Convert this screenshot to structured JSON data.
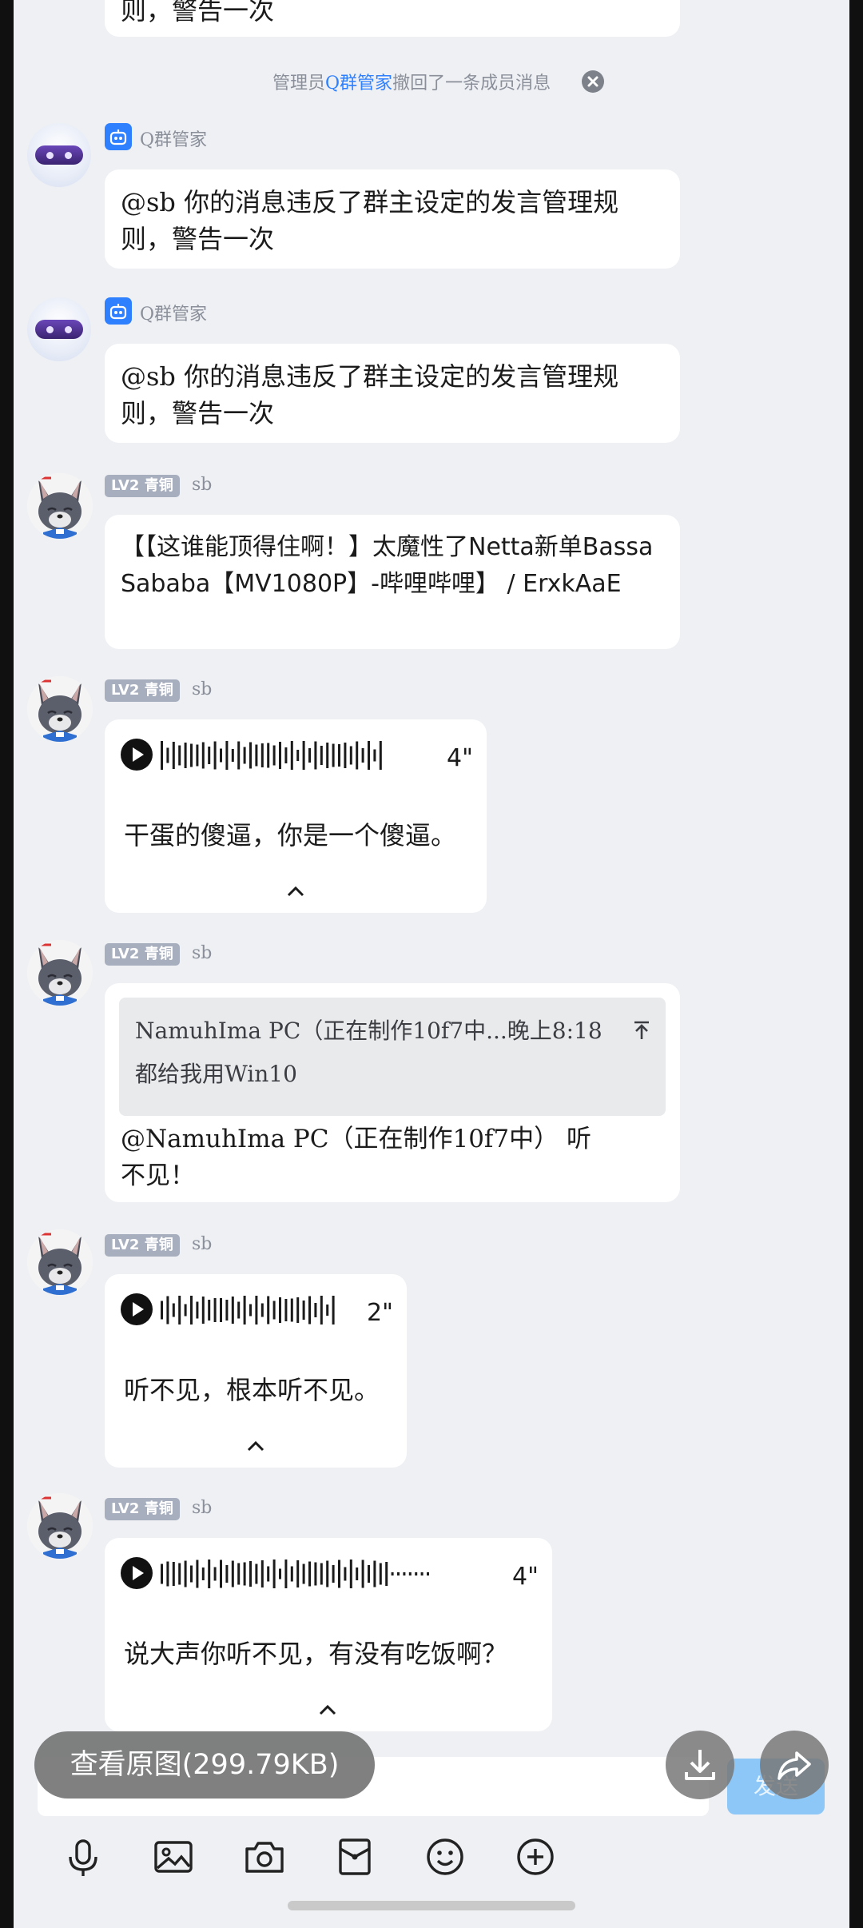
{
  "chat": {
    "top_partial_text": "则，警告一次",
    "system_notice": {
      "prefix": "管理员",
      "actor": "Q群管家",
      "suffix": "撤回了一条成员消息"
    },
    "messages": [
      {
        "type": "bot",
        "sender": "Q群管家",
        "text": "@sb 你的消息违反了群主设定的发言管理规则，警告一次"
      },
      {
        "type": "bot",
        "sender": "Q群管家",
        "text": "@sb 你的消息违反了群主设定的发言管理规则，警告一次"
      },
      {
        "type": "user",
        "level": "LV2 青铜",
        "sender": "sb",
        "text": "【【这谁能顶得住啊！】太魔性了Netta新单Bassa Sababa【MV1080P】-哔哩哔哩】 / ErxkAaE"
      },
      {
        "type": "voice",
        "level": "LV2 青铜",
        "sender": "sb",
        "duration": "4\"",
        "transcript": "干蛋的傻逼，你是一个傻逼。"
      },
      {
        "type": "reply",
        "level": "LV2 青铜",
        "sender": "sb",
        "quote_line1": "NamuhIma PC（正在制作10f7中...晚上8:18",
        "quote_line2": "都给我用Win10",
        "text": "@NamuhIma PC（正在制作10f7中） 听不见！"
      },
      {
        "type": "voice",
        "level": "LV2 青铜",
        "sender": "sb",
        "duration": "2\"",
        "transcript": "听不见，根本听不见。"
      },
      {
        "type": "voice",
        "level": "LV2 青铜",
        "sender": "sb",
        "duration": "4\"",
        "transcript": "说大声你听不见，有没有吃饭啊？"
      }
    ]
  },
  "input": {
    "send_label": "发送"
  },
  "overlay": {
    "view_original_label": "查看原图(299.79KB)"
  },
  "toolbar": {
    "icons": [
      "microphone-icon",
      "image-icon",
      "camera-icon",
      "red-packet-icon",
      "emoji-icon",
      "plus-icon"
    ]
  },
  "colors": {
    "background": "#eef0f4",
    "bubble": "#ffffff",
    "accent": "#2f80ff",
    "level_badge": "#a7aebd",
    "send_button": "#8cc7f7"
  }
}
